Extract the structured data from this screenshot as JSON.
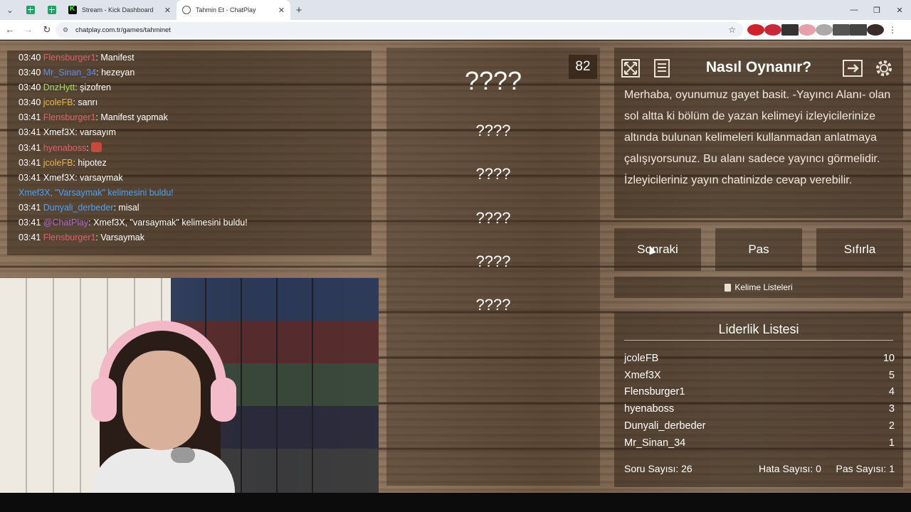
{
  "browser": {
    "tabs": [
      {
        "title": "Stream - Kick Dashboard",
        "active": false
      },
      {
        "title": "Tahmin Et - ChatPlay",
        "active": true
      }
    ],
    "url": "chatplay.com.tr/games/tahminet"
  },
  "chat": {
    "messages": [
      {
        "time": "03:40",
        "user": "Flensburger1",
        "color": "#e0606a",
        "text": ": Manifest"
      },
      {
        "time": "03:40",
        "user": "Mr_Sinan_34",
        "color": "#5b8fe8",
        "text": ": hezeyan"
      },
      {
        "time": "03:40",
        "user": "DnzHytt",
        "color": "#9ee05a",
        "text": ": şizofren"
      },
      {
        "time": "03:40",
        "user": "jcoleFB",
        "color": "#e8b64a",
        "text": ": sanrı"
      },
      {
        "time": "03:41",
        "user": "Flensburger1",
        "color": "#e0606a",
        "text": ": Manifest yapmak"
      },
      {
        "time": "03:41",
        "user": "Xmef3X",
        "color": "#ffffff",
        "text": ": varsayım"
      },
      {
        "time": "03:41",
        "user": "hyenaboss",
        "color": "#e0606a",
        "text": ": ",
        "emote": true
      },
      {
        "time": "03:41",
        "user": "jcoleFB",
        "color": "#e8b64a",
        "text": ": hipotez"
      },
      {
        "time": "03:41",
        "user": "Xmef3X",
        "color": "#ffffff",
        "text": ": varsaymak"
      },
      {
        "system": true,
        "text": "Xmef3X, \"Varsaymak\" kelimesini buldu!"
      },
      {
        "time": "03:41",
        "user": "Dunyali_derbeder",
        "color": "#4aa3ff",
        "text": ": misal"
      },
      {
        "time": "03:41",
        "user": "@ChatPlay",
        "color": "#b06ad8",
        "text": ": Xmef3X, \"varsaymak\" kelimesini buldu!"
      },
      {
        "time": "03:41",
        "user": "Flensburger1",
        "color": "#e0606a",
        "text": ": Varsaymak"
      }
    ]
  },
  "game": {
    "counter": "82",
    "words": [
      "????",
      "????",
      "????",
      "????",
      "????",
      "????"
    ]
  },
  "howto": {
    "title": "Nasıl Oynanır?",
    "text": "Merhaba, oyunumuz gayet basit. -Yayıncı Alanı- olan sol altta ki bölüm de yazan kelimeyi izleyicilerinize altında bulunan kelimeleri kullanmadan anlatmaya çalışıyorsunuz. Bu alanı sadece yayıncı görmelidir. İzleyicileriniz yayın chatinizde cevap verebilir."
  },
  "buttons": {
    "next": "Sonraki",
    "pass": "Pas",
    "reset": "Sıfırla",
    "lists": "Kelime Listeleri"
  },
  "leaderboard": {
    "title": "Liderlik Listesi",
    "rows": [
      {
        "name": "jcoleFB",
        "score": "10"
      },
      {
        "name": "Xmef3X",
        "score": "5"
      },
      {
        "name": "Flensburger1",
        "score": "4"
      },
      {
        "name": "hyenaboss",
        "score": "3"
      },
      {
        "name": "Dunyali_derbeder",
        "score": "2"
      },
      {
        "name": "Mr_Sinan_34",
        "score": "1"
      }
    ],
    "questions": "Soru Sayısı: 26",
    "errors": "Hata Sayısı: 0",
    "passes": "Pas Sayısı: 1"
  }
}
